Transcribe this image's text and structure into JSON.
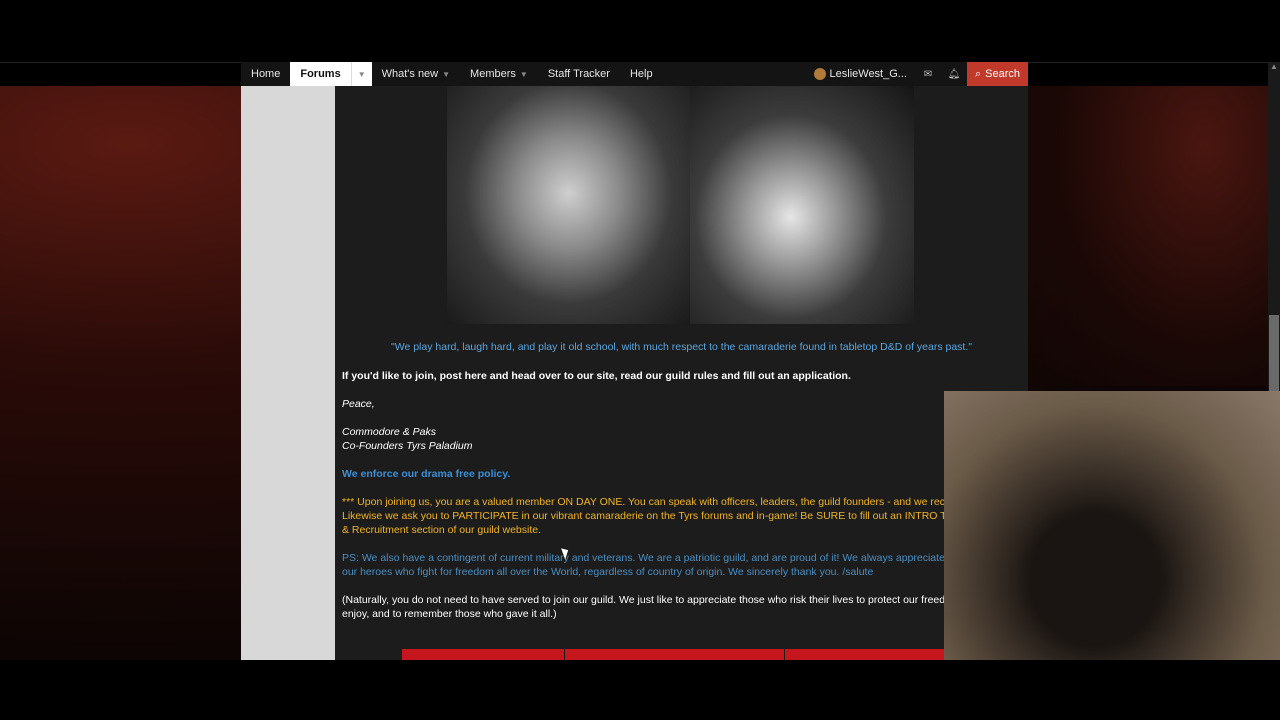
{
  "nav": {
    "items": [
      {
        "label": "Home"
      },
      {
        "label": "Forums"
      },
      {
        "label": "What's new"
      },
      {
        "label": "Members"
      },
      {
        "label": "Staff Tracker"
      },
      {
        "label": "Help"
      }
    ],
    "username": "LeslieWest_G...",
    "search_label": "Search"
  },
  "post": {
    "quote": "\"We play hard, laugh hard, and play it old school, with much respect to the camaraderie found in tabletop D&D of years past.\"",
    "join_line": "If you'd like to join, post here and head over to our site, read our guild rules and fill out an application.",
    "peace": "Peace,",
    "sig_names": "Commodore & Paks",
    "sig_title": "Co-Founders Tyrs Paladium",
    "drama": "We enforce our drama free policy.",
    "joining_1": "*** Upon joining us, you are a valued member ON DAY ONE. You can speak with officers, leaders, the guild founders - and we recom",
    "joining_2": "Likewise we ask you to PARTICIPATE in our vibrant camaraderie on the Tyrs forums and in-game! Be SURE to fill out an INTRO THREA",
    "joining_3": "& Recruitment section of our guild website.",
    "ps_1": "PS: We also have a contingent of current military and veterans. We are a patriotic guild, and are proud of it! We always appreciate ar",
    "ps_2": "our heroes who fight for freedom all over the World, regardless of country of origin. We sincerely thank you. /salute",
    "natural_1": "(Naturally, you do not need to have served to join our guild. We just like to appreciate those who risk their lives to protect our freed",
    "natural_2": "enjoy, and to remember those who gave it all.)"
  }
}
